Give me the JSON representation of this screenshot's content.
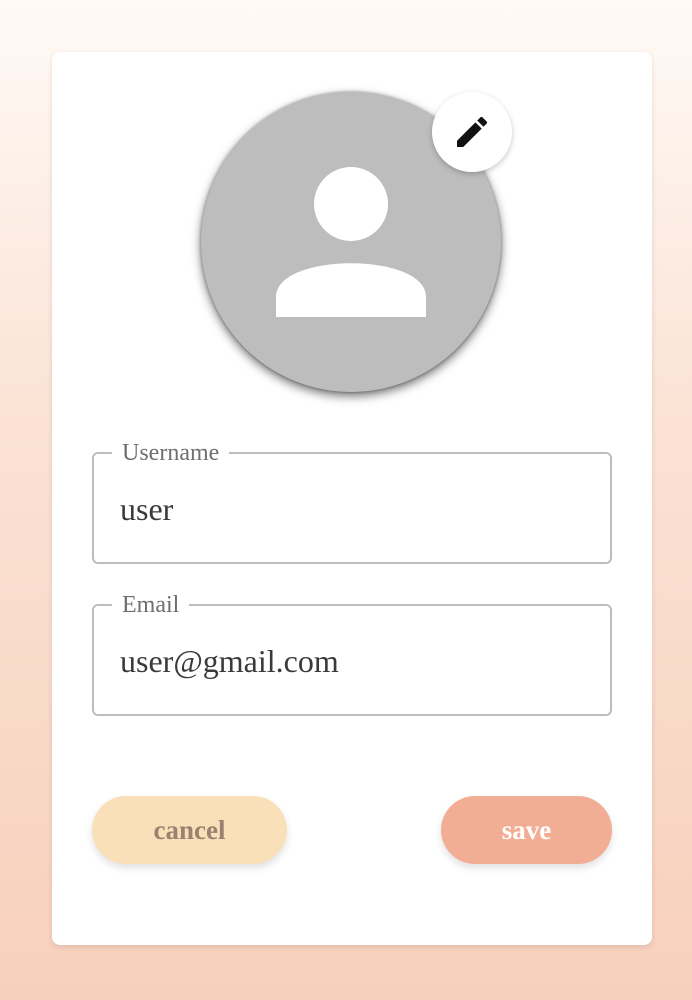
{
  "profile": {
    "avatar_icon": "person-icon",
    "edit_icon": "pencil-icon"
  },
  "form": {
    "username": {
      "label": "Username",
      "value": "user"
    },
    "email": {
      "label": "Email",
      "value": "user@gmail.com"
    }
  },
  "actions": {
    "cancel_label": "cancel",
    "save_label": "save"
  },
  "colors": {
    "cancel_button": "#f9e0b8",
    "save_button": "#f2ad95",
    "avatar_background": "#bdbdbd"
  }
}
